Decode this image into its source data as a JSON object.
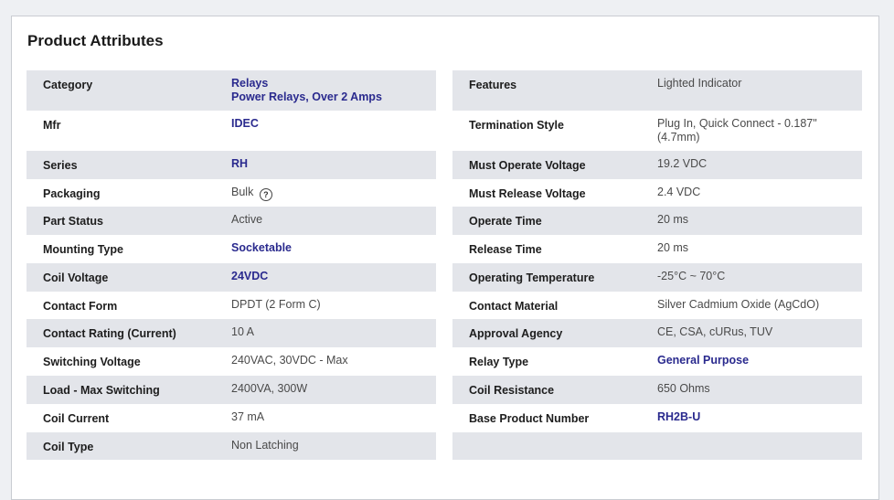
{
  "title": "Product Attributes",
  "left": [
    {
      "label": "Category",
      "values": [
        "Relays",
        "Power Relays, Over 2 Amps"
      ],
      "link": true
    },
    {
      "label": "Mfr",
      "values": [
        "IDEC"
      ],
      "link": true
    },
    {
      "label": "Series",
      "values": [
        "RH"
      ],
      "link": true
    },
    {
      "label": "Packaging",
      "values": [
        "Bulk"
      ],
      "help": "?"
    },
    {
      "label": "Part Status",
      "values": [
        "Active"
      ]
    },
    {
      "label": "Mounting Type",
      "values": [
        "Socketable"
      ],
      "link": true
    },
    {
      "label": "Coil Voltage",
      "values": [
        "24VDC"
      ],
      "link": true
    },
    {
      "label": "Contact Form",
      "values": [
        "DPDT (2 Form C)"
      ]
    },
    {
      "label": "Contact Rating (Current)",
      "values": [
        "10 A"
      ]
    },
    {
      "label": "Switching Voltage",
      "values": [
        "240VAC, 30VDC - Max"
      ]
    },
    {
      "label": "Load - Max Switching",
      "values": [
        "2400VA, 300W"
      ]
    },
    {
      "label": "Coil Current",
      "values": [
        "37 mA"
      ]
    },
    {
      "label": "Coil Type",
      "values": [
        "Non Latching"
      ]
    }
  ],
  "right": [
    {
      "label": "Features",
      "values": [
        "Lighted Indicator"
      ]
    },
    {
      "label": "Termination Style",
      "values": [
        "Plug In, Quick Connect - 0.187\"",
        "(4.7mm)"
      ]
    },
    {
      "label": "Must Operate Voltage",
      "values": [
        "19.2 VDC"
      ]
    },
    {
      "label": "Must Release Voltage",
      "values": [
        "2.4 VDC"
      ]
    },
    {
      "label": "Operate Time",
      "values": [
        "20 ms"
      ]
    },
    {
      "label": "Release Time",
      "values": [
        "20 ms"
      ]
    },
    {
      "label": "Operating Temperature",
      "values": [
        "-25°C ~ 70°C"
      ]
    },
    {
      "label": "Contact Material",
      "values": [
        "Silver Cadmium Oxide (AgCdO)"
      ]
    },
    {
      "label": "Approval Agency",
      "values": [
        "CE, CSA, cURus, TUV"
      ]
    },
    {
      "label": "Relay Type",
      "values": [
        "General Purpose"
      ],
      "link": true
    },
    {
      "label": "Coil Resistance",
      "values": [
        "650 Ohms"
      ]
    },
    {
      "label": "Base Product Number",
      "values": [
        "RH2B-U"
      ],
      "link": true
    },
    {
      "label": "",
      "values": []
    }
  ]
}
